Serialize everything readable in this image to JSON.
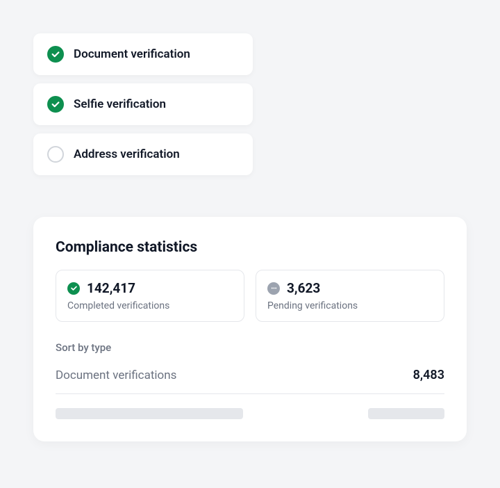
{
  "steps": [
    {
      "label": "Document verification",
      "done": true
    },
    {
      "label": "Selfie verification",
      "done": true
    },
    {
      "label": "Address verification",
      "done": false
    }
  ],
  "stats": {
    "title": "Compliance statistics",
    "completed": {
      "value": "142,417",
      "label": "Completed verifications"
    },
    "pending": {
      "value": "3,623",
      "label": "Pending verifications"
    },
    "sortLabel": "Sort by type",
    "types": [
      {
        "name": "Document verifications",
        "count": "8,483"
      }
    ]
  }
}
